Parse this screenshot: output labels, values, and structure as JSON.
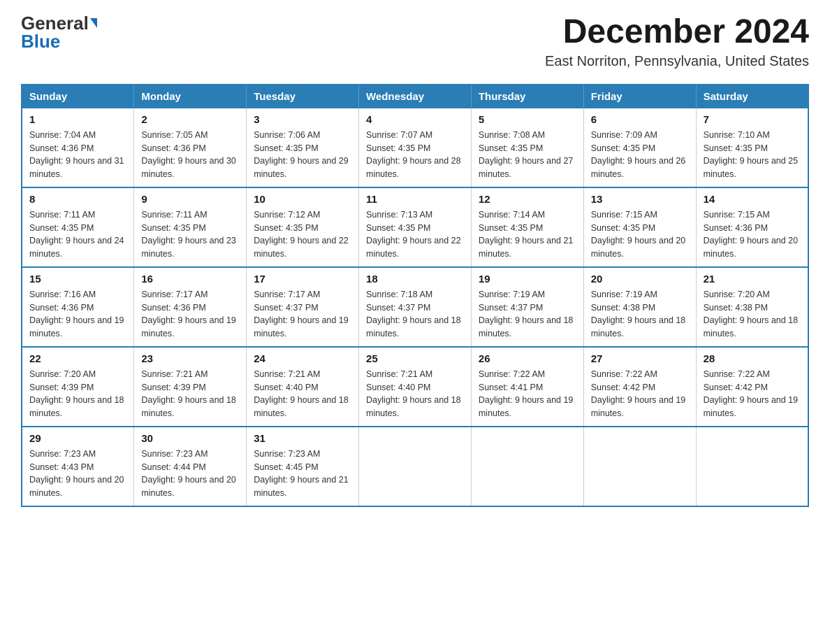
{
  "header": {
    "logo_general": "General",
    "logo_blue": "Blue",
    "month_title": "December 2024",
    "location": "East Norriton, Pennsylvania, United States"
  },
  "weekdays": [
    "Sunday",
    "Monday",
    "Tuesday",
    "Wednesday",
    "Thursday",
    "Friday",
    "Saturday"
  ],
  "weeks": [
    [
      {
        "day": "1",
        "sunrise": "7:04 AM",
        "sunset": "4:36 PM",
        "daylight": "9 hours and 31 minutes."
      },
      {
        "day": "2",
        "sunrise": "7:05 AM",
        "sunset": "4:36 PM",
        "daylight": "9 hours and 30 minutes."
      },
      {
        "day": "3",
        "sunrise": "7:06 AM",
        "sunset": "4:35 PM",
        "daylight": "9 hours and 29 minutes."
      },
      {
        "day": "4",
        "sunrise": "7:07 AM",
        "sunset": "4:35 PM",
        "daylight": "9 hours and 28 minutes."
      },
      {
        "day": "5",
        "sunrise": "7:08 AM",
        "sunset": "4:35 PM",
        "daylight": "9 hours and 27 minutes."
      },
      {
        "day": "6",
        "sunrise": "7:09 AM",
        "sunset": "4:35 PM",
        "daylight": "9 hours and 26 minutes."
      },
      {
        "day": "7",
        "sunrise": "7:10 AM",
        "sunset": "4:35 PM",
        "daylight": "9 hours and 25 minutes."
      }
    ],
    [
      {
        "day": "8",
        "sunrise": "7:11 AM",
        "sunset": "4:35 PM",
        "daylight": "9 hours and 24 minutes."
      },
      {
        "day": "9",
        "sunrise": "7:11 AM",
        "sunset": "4:35 PM",
        "daylight": "9 hours and 23 minutes."
      },
      {
        "day": "10",
        "sunrise": "7:12 AM",
        "sunset": "4:35 PM",
        "daylight": "9 hours and 22 minutes."
      },
      {
        "day": "11",
        "sunrise": "7:13 AM",
        "sunset": "4:35 PM",
        "daylight": "9 hours and 22 minutes."
      },
      {
        "day": "12",
        "sunrise": "7:14 AM",
        "sunset": "4:35 PM",
        "daylight": "9 hours and 21 minutes."
      },
      {
        "day": "13",
        "sunrise": "7:15 AM",
        "sunset": "4:35 PM",
        "daylight": "9 hours and 20 minutes."
      },
      {
        "day": "14",
        "sunrise": "7:15 AM",
        "sunset": "4:36 PM",
        "daylight": "9 hours and 20 minutes."
      }
    ],
    [
      {
        "day": "15",
        "sunrise": "7:16 AM",
        "sunset": "4:36 PM",
        "daylight": "9 hours and 19 minutes."
      },
      {
        "day": "16",
        "sunrise": "7:17 AM",
        "sunset": "4:36 PM",
        "daylight": "9 hours and 19 minutes."
      },
      {
        "day": "17",
        "sunrise": "7:17 AM",
        "sunset": "4:37 PM",
        "daylight": "9 hours and 19 minutes."
      },
      {
        "day": "18",
        "sunrise": "7:18 AM",
        "sunset": "4:37 PM",
        "daylight": "9 hours and 18 minutes."
      },
      {
        "day": "19",
        "sunrise": "7:19 AM",
        "sunset": "4:37 PM",
        "daylight": "9 hours and 18 minutes."
      },
      {
        "day": "20",
        "sunrise": "7:19 AM",
        "sunset": "4:38 PM",
        "daylight": "9 hours and 18 minutes."
      },
      {
        "day": "21",
        "sunrise": "7:20 AM",
        "sunset": "4:38 PM",
        "daylight": "9 hours and 18 minutes."
      }
    ],
    [
      {
        "day": "22",
        "sunrise": "7:20 AM",
        "sunset": "4:39 PM",
        "daylight": "9 hours and 18 minutes."
      },
      {
        "day": "23",
        "sunrise": "7:21 AM",
        "sunset": "4:39 PM",
        "daylight": "9 hours and 18 minutes."
      },
      {
        "day": "24",
        "sunrise": "7:21 AM",
        "sunset": "4:40 PM",
        "daylight": "9 hours and 18 minutes."
      },
      {
        "day": "25",
        "sunrise": "7:21 AM",
        "sunset": "4:40 PM",
        "daylight": "9 hours and 18 minutes."
      },
      {
        "day": "26",
        "sunrise": "7:22 AM",
        "sunset": "4:41 PM",
        "daylight": "9 hours and 19 minutes."
      },
      {
        "day": "27",
        "sunrise": "7:22 AM",
        "sunset": "4:42 PM",
        "daylight": "9 hours and 19 minutes."
      },
      {
        "day": "28",
        "sunrise": "7:22 AM",
        "sunset": "4:42 PM",
        "daylight": "9 hours and 19 minutes."
      }
    ],
    [
      {
        "day": "29",
        "sunrise": "7:23 AM",
        "sunset": "4:43 PM",
        "daylight": "9 hours and 20 minutes."
      },
      {
        "day": "30",
        "sunrise": "7:23 AM",
        "sunset": "4:44 PM",
        "daylight": "9 hours and 20 minutes."
      },
      {
        "day": "31",
        "sunrise": "7:23 AM",
        "sunset": "4:45 PM",
        "daylight": "9 hours and 21 minutes."
      },
      null,
      null,
      null,
      null
    ]
  ],
  "labels": {
    "sunrise": "Sunrise: ",
    "sunset": "Sunset: ",
    "daylight": "Daylight: "
  }
}
